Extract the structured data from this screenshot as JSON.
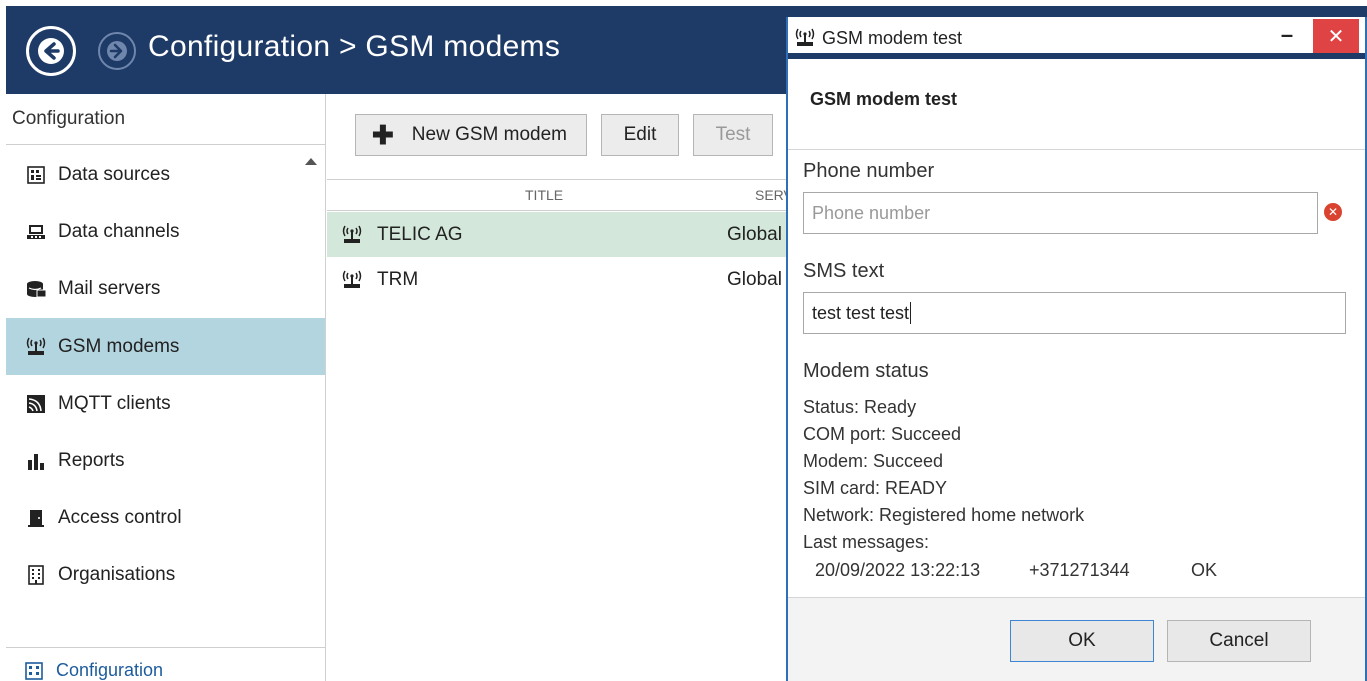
{
  "header": {
    "title": "Configuration > GSM modems"
  },
  "sidebar": {
    "heading": "Configuration",
    "items": [
      {
        "label": "Data sources",
        "icon": "data-sources-icon"
      },
      {
        "label": "Data channels",
        "icon": "data-channels-icon"
      },
      {
        "label": "Mail servers",
        "icon": "mail-servers-icon"
      },
      {
        "label": "GSM modems",
        "icon": "gsm-modem-icon",
        "active": true
      },
      {
        "label": "MQTT clients",
        "icon": "mqtt-icon"
      },
      {
        "label": "Reports",
        "icon": "reports-icon"
      },
      {
        "label": "Access control",
        "icon": "access-control-icon"
      },
      {
        "label": "Organisations",
        "icon": "organisations-icon"
      }
    ],
    "footer": "Configuration"
  },
  "toolbar": {
    "new_label": "New GSM modem",
    "edit_label": "Edit",
    "test_label": "Test"
  },
  "grid": {
    "columns": [
      "TITLE",
      "SERV"
    ],
    "rows": [
      {
        "title": "TELIC AG",
        "server": "Global",
        "selected": true
      },
      {
        "title": "TRM",
        "server": "Global",
        "selected": false
      }
    ]
  },
  "dialog": {
    "window_title": "GSM modem test",
    "heading": "GSM modem test",
    "phone_label": "Phone number",
    "phone_placeholder": "Phone number",
    "phone_value": "",
    "sms_label": "SMS text",
    "sms_value": "test test test",
    "status_heading": "Modem status",
    "status_lines": [
      "Status: Ready",
      "COM port: Succeed",
      "Modem: Succeed",
      "SIM card: READY",
      "Network: Registered home network",
      "Last messages:"
    ],
    "last_message": {
      "time": "20/09/2022 13:22:13",
      "number": "+371271344",
      "result": "OK"
    },
    "ok_label": "OK",
    "cancel_label": "Cancel"
  },
  "colors": {
    "header_bg": "#1e3a66",
    "active_item": "#b3d5df",
    "selected_row": "#d3e8da",
    "close_button": "#e04343",
    "accent_border": "#2e6fb7"
  }
}
